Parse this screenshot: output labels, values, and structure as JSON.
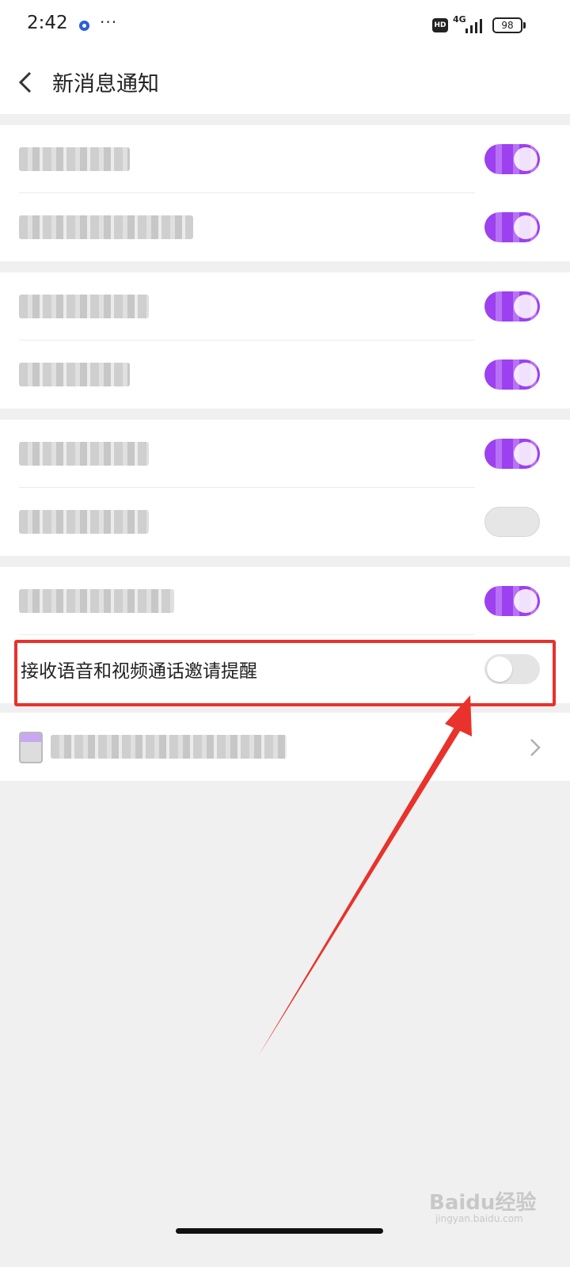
{
  "status_bar": {
    "time": "2:42",
    "dots": "···",
    "hd": "HD",
    "network": "4G",
    "battery": "98"
  },
  "header": {
    "back_icon": "chevron-left-icon",
    "title": "新消息通知"
  },
  "settings": {
    "highlighted_row": {
      "label": "接收语音和视频通话邀请提醒",
      "enabled": false
    },
    "toggle_states": [
      true,
      true,
      true,
      true,
      true,
      false,
      true
    ],
    "last_row_icon": "chevron-right-icon"
  },
  "colors": {
    "accent": "#a24ff3",
    "highlight": "#e8322b",
    "background": "#f0f0f0"
  },
  "watermark": {
    "text": "Baidu经验",
    "sub": "jingyan.baidu.com"
  }
}
